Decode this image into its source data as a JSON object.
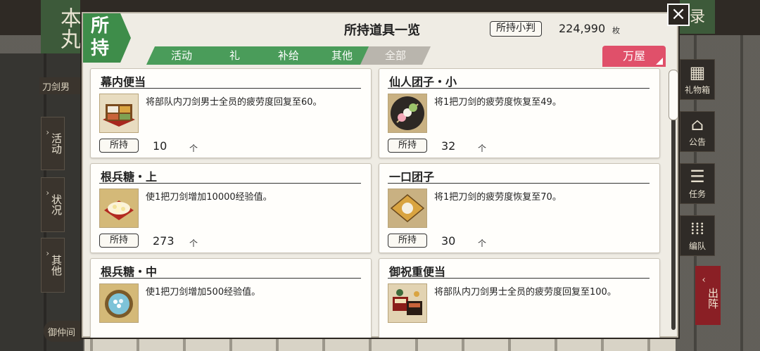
{
  "background": {
    "honmaru": "本丸",
    "left_label": "刀剑男",
    "side_buttons": [
      "活动",
      "状况",
      "其他"
    ],
    "bottom_label": "御仲间",
    "right_buttons": [
      {
        "label": "礼物箱",
        "icon": "gift-icon"
      },
      {
        "label": "公告",
        "icon": "house-icon"
      },
      {
        "label": "任务",
        "icon": "checklist-icon"
      },
      {
        "label": "编队",
        "icon": "formation-icon"
      }
    ],
    "top_right": "录",
    "shutsujin": "出阵"
  },
  "modal": {
    "badge": "所持",
    "title": "所持道具一览",
    "koban_label": "所持小判",
    "koban_value": "224,990",
    "koban_unit": "枚",
    "tabs": [
      "活动",
      "礼",
      "补给",
      "其他",
      "全部"
    ],
    "active_tab": "全部",
    "shop_label": "万屋",
    "own_label": "所持",
    "count_unit": "个",
    "items": [
      {
        "name": "幕内便当",
        "desc": "将部队内刀剑男士全员的疲劳度回复至60。",
        "count": "10",
        "icon": "bento-box-icon"
      },
      {
        "name": "仙人团子・小",
        "desc": "将1把刀剑的疲劳度恢复至49。",
        "count": "32",
        "icon": "dango-skewer-icon"
      },
      {
        "name": "根兵糖・上",
        "desc": "使1把刀剑增加10000经验值。",
        "count": "273",
        "icon": "konpeito-plate-icon"
      },
      {
        "name": "一口团子",
        "desc": "将1把刀剑的疲劳度恢复至70。",
        "count": "30",
        "icon": "dango-plate-icon"
      },
      {
        "name": "根兵糖・中",
        "desc": "使1把刀剑增加500经验值。",
        "count": "",
        "icon": "konpeito-bowl-icon"
      },
      {
        "name": "御祝重便当",
        "desc": "将部队内刀剑男士全员的疲劳度回复至100。",
        "count": "",
        "icon": "celebration-bento-icon"
      }
    ]
  },
  "colors": {
    "green": "#3e8d4a",
    "tab_green": "#4a9c5a",
    "pink": "#e0506a",
    "red": "#8a1f25"
  }
}
